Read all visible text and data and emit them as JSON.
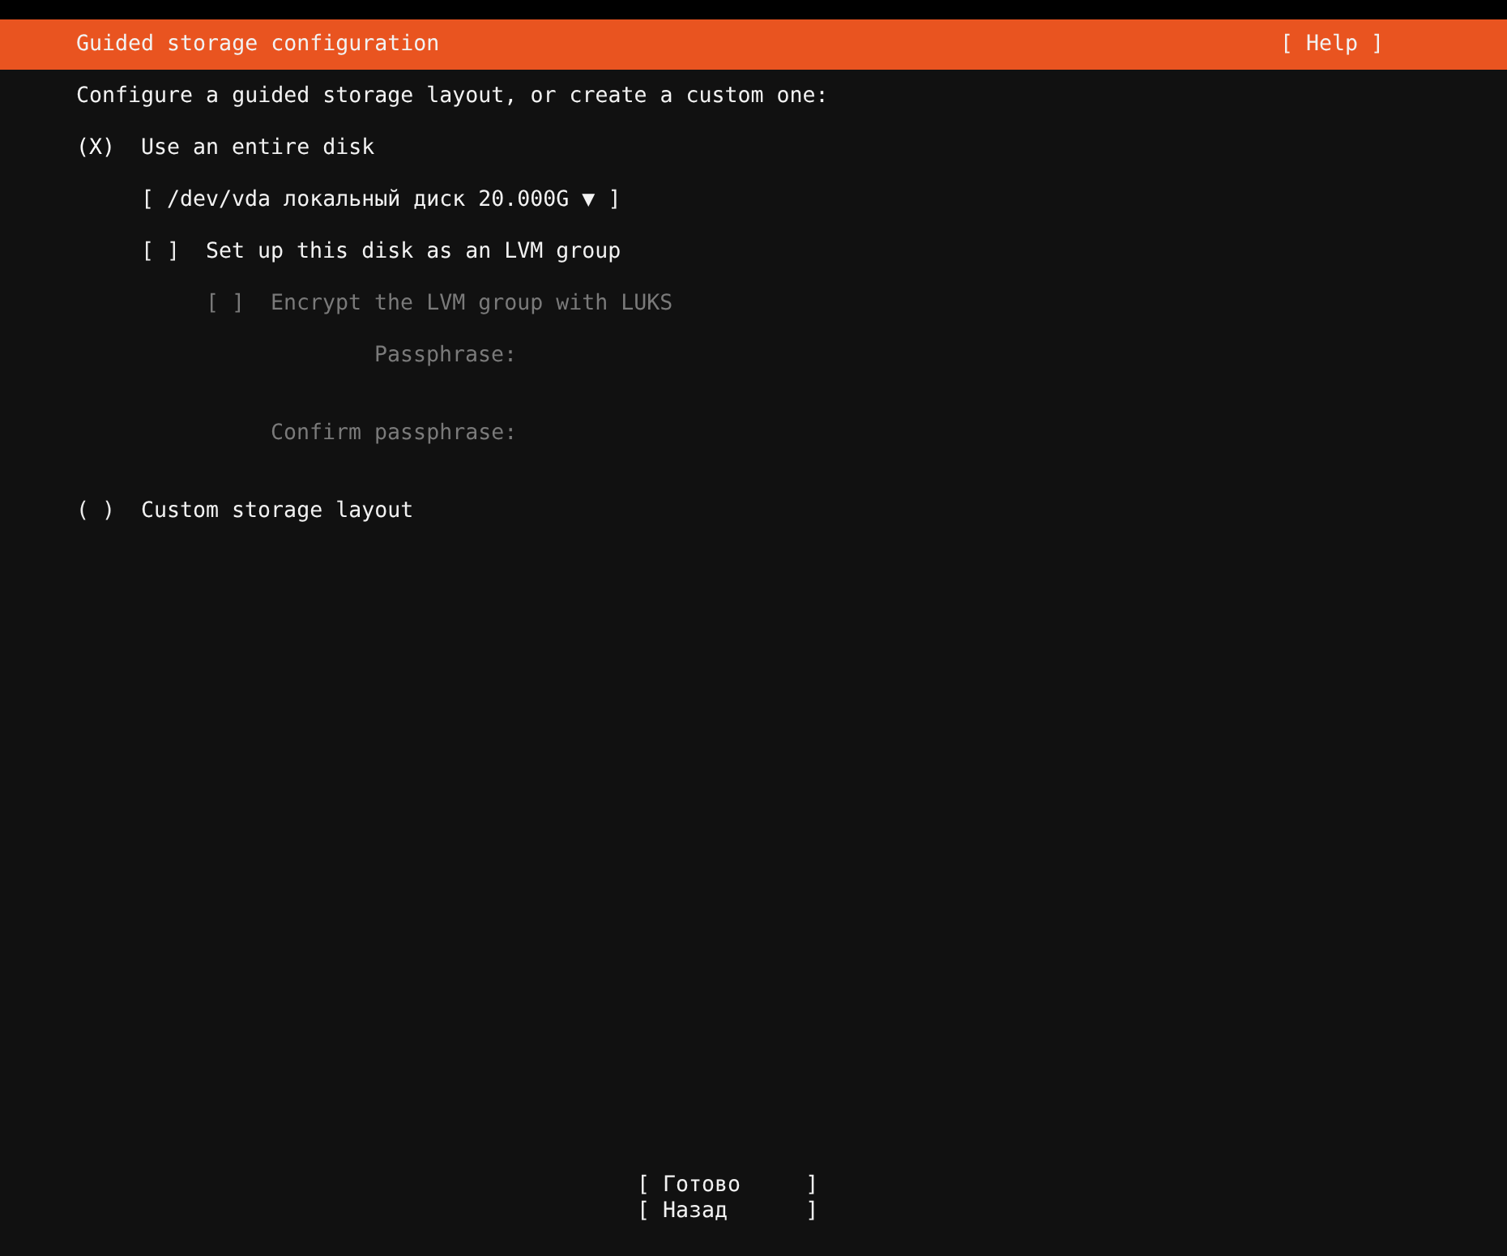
{
  "header": {
    "title": "Guided storage configuration",
    "help": "[ Help ]"
  },
  "intro": "Configure a guided storage layout, or create a custom one:",
  "entire_disk": {
    "marker": "(X)",
    "label": "Use an entire disk",
    "selected": true
  },
  "disk_select": {
    "value": "[ /dev/vda локальный диск 20.000G ▼ ]"
  },
  "lvm": {
    "marker": "[ ]",
    "label": "Set up this disk as an LVM group",
    "checked": false,
    "disabled": false
  },
  "luks": {
    "marker": "[ ]",
    "label": "Encrypt the LVM group with LUKS",
    "checked": false,
    "disabled": true
  },
  "passphrase_fields": [
    {
      "label": "Passphrase:",
      "disabled": true
    },
    {
      "label": "Confirm passphrase:",
      "disabled": true
    }
  ],
  "custom_layout": {
    "marker": "( )",
    "label": "Custom storage layout",
    "selected": false
  },
  "buttons": [
    "[ Готово     ]",
    "[ Назад      ]"
  ]
}
